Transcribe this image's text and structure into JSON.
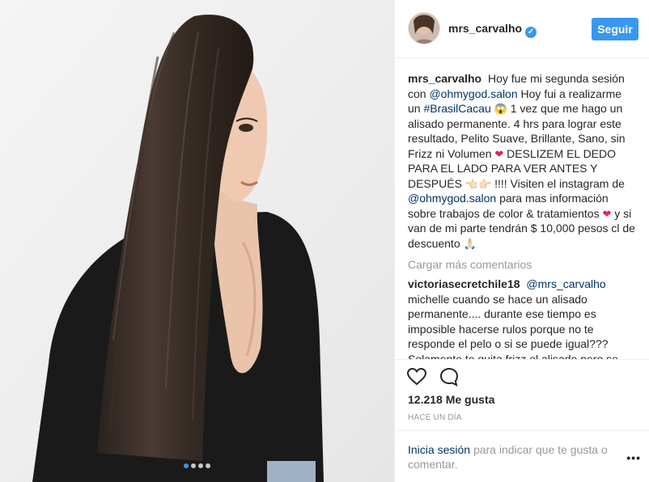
{
  "post": {
    "username": "mrs_carvalho",
    "follow_label": "Seguir",
    "carousel": {
      "total": 4,
      "active": 0
    }
  },
  "caption": {
    "username": "mrs_carvalho",
    "part1": "Hoy fue mi segunda sesión con",
    "mention1": "@ohmygod.salon",
    "part2": "Hoy fui a realizarme un",
    "hashtag": "#BrasilCacau",
    "emoji1": "😱",
    "part3": "1 vez que me hago un alisado permanente. 4 hrs para lograr este resultado, Pelito Suave, Brillante, Sano, sin Frizz ni Volumen",
    "emoji2": "❤",
    "part4": "DESLIZEM EL DEDO PARA EL LADO PARA VER ANTES Y DESPUÉS",
    "emoji3": "👈🏻👉🏻",
    "part5": "!!!! Visiten el instagram de",
    "mention2": "@ohmygod.salon",
    "part6": "para mas información sobre trabajos de color & tratamientos",
    "emoji4": "❤",
    "part7": "y si van de mi parte tendrán $ 10,000 pesos cl de descuento",
    "emoji5": "🙏🏻"
  },
  "load_more": "Cargar más comentarios",
  "comment": {
    "username": "victoriasecretchile18",
    "mention": "@mrs_carvalho",
    "text": "michelle cuando se hace un alisado permanente.... durante ese tiempo es imposible hacerse rulos porque no te responde el pelo o si se puede igual??? Solamente te quita frizz el alisado pero se"
  },
  "likes": "12.218 Me gusta",
  "time": "HACE UN DÍA",
  "login": {
    "link": "Inicia sesión",
    "text": "para indicar que te gusta o comentar."
  },
  "more_label": "•••",
  "colors": {
    "accent": "#3897f0",
    "link": "#003569",
    "muted": "#999999",
    "text": "#262626"
  },
  "icons": {
    "like": "heart-outline-icon",
    "comment": "speech-bubble-icon",
    "verified": "verified-badge-icon",
    "more": "ellipsis-icon"
  }
}
